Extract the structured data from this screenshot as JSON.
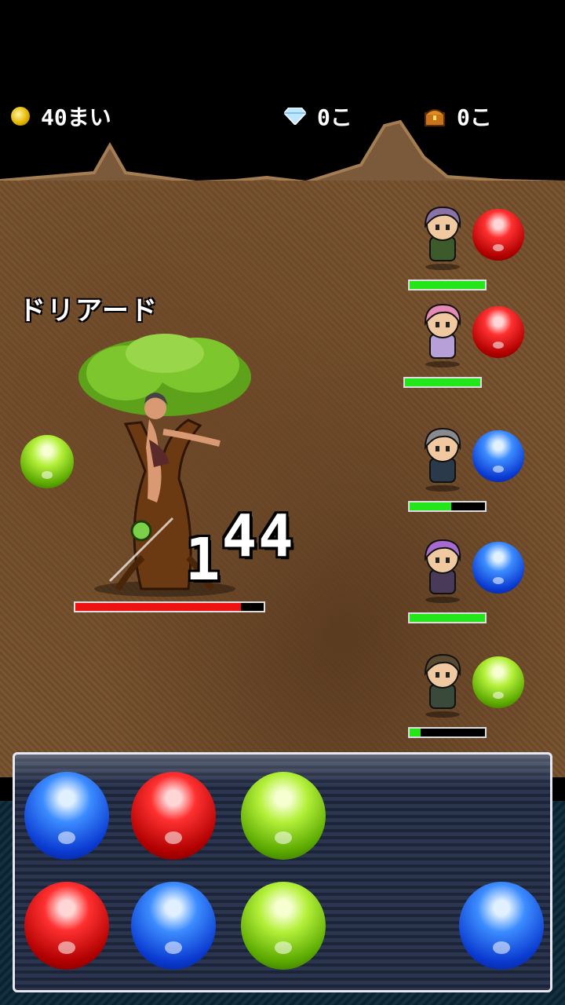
{
  "hud": {
    "coins": "40まい",
    "gems": "0こ",
    "chests": "0こ",
    "coin_icon": "gold-coin-icon",
    "gem_icon": "diamond-icon",
    "chest_icon": "treasure-chest-icon"
  },
  "enemy": {
    "name": "ドリアード",
    "hp_fraction": 0.88,
    "orb": "green",
    "damage": [
      "1",
      "44"
    ]
  },
  "party": [
    {
      "orb": "red",
      "hp_fraction": 1.0
    },
    {
      "orb": "red",
      "hp_fraction": 1.0
    },
    {
      "orb": "blue",
      "hp_fraction": 0.55
    },
    {
      "orb": "blue",
      "hp_fraction": 1.0
    },
    {
      "orb": "green",
      "hp_fraction": 0.15
    }
  ],
  "board": {
    "rows": [
      [
        "blue",
        "red",
        "green",
        null,
        null
      ],
      [
        "red",
        "blue",
        "green",
        null,
        "blue"
      ]
    ]
  },
  "colors": {
    "hp_green": "#22e51a",
    "hp_red": "#ee1111"
  }
}
